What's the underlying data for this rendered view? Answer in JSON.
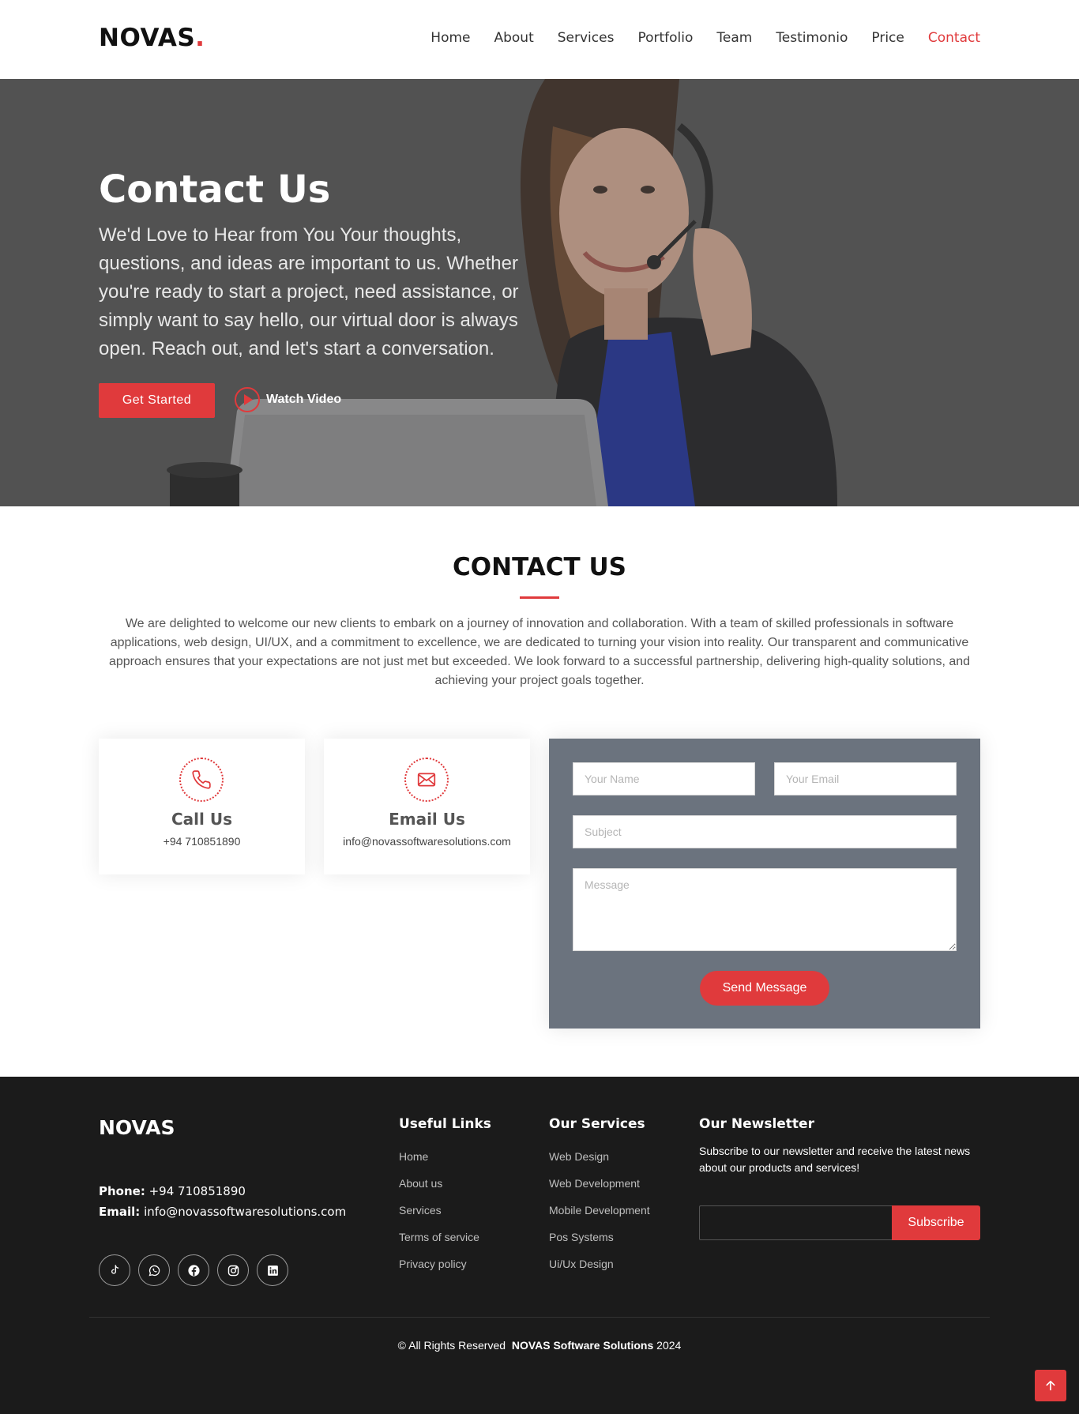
{
  "header": {
    "logo_text": "NOVAS",
    "logo_dot": ".",
    "nav": [
      "Home",
      "About",
      "Services",
      "Portfolio",
      "Team",
      "Testimonio",
      "Price",
      "Contact"
    ],
    "active_nav": "Contact"
  },
  "hero": {
    "title": "Contact Us",
    "text": "We'd Love to Hear from You Your thoughts, questions, and ideas are important to us. Whether you're ready to start a project, need assistance, or simply want to say hello, our virtual door is always open. Reach out, and let's start a conversation.",
    "cta_label": "Get Started",
    "video_label": "Watch Video"
  },
  "contact_section": {
    "title": "CONTACT US",
    "description": "We are delighted to welcome our new clients to embark on a journey of innovation and collaboration. With a team of skilled professionals in software applications, web design, UI/UX, and a commitment to excellence, we are dedicated to turning your vision into reality. Our transparent and communicative approach ensures that your expectations are not just met but exceeded. We look forward to a successful partnership, delivering high-quality solutions, and achieving your project goals together."
  },
  "cards": {
    "call": {
      "title": "Call Us",
      "value": "+94 710851890",
      "icon": "phone-icon"
    },
    "email": {
      "title": "Email Us",
      "value": "info@novassoftwaresolutions.com",
      "icon": "envelope-icon"
    }
  },
  "form": {
    "name_placeholder": "Your Name",
    "email_placeholder": "Your Email",
    "subject_placeholder": "Subject",
    "message_placeholder": "Message",
    "submit_label": "Send Message"
  },
  "footer": {
    "logo": "NOVAS",
    "phone_label": "Phone:",
    "phone": "+94 710851890",
    "email_label": "Email:",
    "email": "info@novassoftwaresolutions.com",
    "socials": [
      "tiktok-icon",
      "whatsapp-icon",
      "facebook-icon",
      "instagram-icon",
      "linkedin-icon"
    ],
    "useful_links": {
      "title": "Useful Links",
      "items": [
        "Home",
        "About us",
        "Services",
        "Terms of service",
        "Privacy policy"
      ]
    },
    "services": {
      "title": "Our Services",
      "items": [
        "Web Design",
        "Web Development",
        "Mobile Development",
        "Pos Systems",
        "Ui/Ux Design"
      ]
    },
    "newsletter": {
      "title": "Our Newsletter",
      "text": "Subscribe to our newsletter and receive the latest news about our products and services!",
      "button_label": "Subscribe"
    },
    "copyright_prefix": "© All Rights Reserved",
    "copyright_company": "NOVAS Software Solutions",
    "copyright_year": "2024"
  },
  "colors": {
    "accent": "#e03a3c",
    "footer_bg": "#1b1b1b",
    "form_bg": "#6b737e",
    "hero_overlay": "#575757"
  }
}
